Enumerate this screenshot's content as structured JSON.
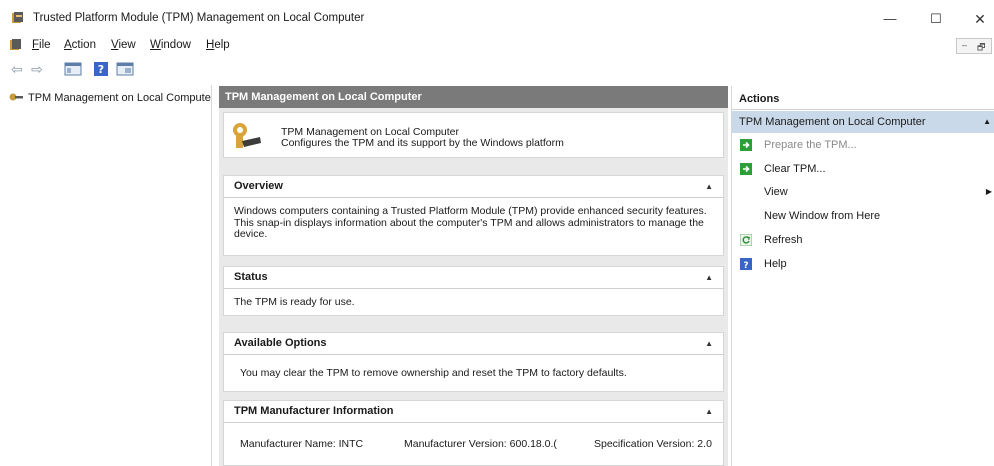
{
  "window": {
    "title": "Trusted Platform Module (TPM) Management on Local Computer",
    "minimize_glyph": "—",
    "maximize_glyph": "☐",
    "close_glyph": "✕"
  },
  "menu": {
    "items": [
      {
        "label": "File",
        "accel": "F",
        "rest": "ile"
      },
      {
        "label": "Action",
        "accel": "A",
        "rest": "ction"
      },
      {
        "label": "View",
        "accel": "V",
        "rest": "iew"
      },
      {
        "label": "Window",
        "accel": "W",
        "rest": "indow"
      },
      {
        "label": "Help",
        "accel": "H",
        "rest": "elp"
      }
    ],
    "mdi_minimize": "–",
    "mdi_restore": "🗗"
  },
  "toolbar": {
    "back_glyph": "⇦",
    "forward_glyph": "⇨",
    "icons": [
      "console-tree-icon",
      "help-icon",
      "properties-icon"
    ]
  },
  "tree": {
    "root_label": "TPM Management on Local Computer"
  },
  "center": {
    "header": "TPM Management on Local Computer",
    "intro_title": "TPM Management on Local Computer",
    "intro_desc": "Configures the TPM and its support by the Windows platform",
    "overview": {
      "title": "Overview",
      "text": "Windows computers containing a Trusted Platform Module (TPM) provide enhanced security features. This snap-in displays information about the computer's TPM and allows administrators to manage the device."
    },
    "status": {
      "title": "Status",
      "text": "The TPM is ready for use."
    },
    "options": {
      "title": "Available Options",
      "text": "You may clear the TPM to remove ownership and reset the TPM to factory defaults."
    },
    "manufacturer": {
      "title": "TPM Manufacturer Information",
      "name": "Manufacturer Name:  INTC",
      "version": "Manufacturer Version:  600.18.0.(",
      "spec": "Specification Version:  2.0"
    },
    "caret_glyph": "▲"
  },
  "actions": {
    "header": "Actions",
    "group": "TPM Management on Local Computer",
    "items": [
      {
        "label": "Prepare the TPM...",
        "icon": "green-action-icon",
        "enabled": false
      },
      {
        "label": "Clear TPM...",
        "icon": "green-action-icon",
        "enabled": true
      },
      {
        "label": "View",
        "icon": "",
        "enabled": true,
        "submenu": true
      },
      {
        "label": "New Window from Here",
        "icon": "",
        "enabled": true
      },
      {
        "label": "Refresh",
        "icon": "refresh-icon",
        "enabled": true
      },
      {
        "label": "Help",
        "icon": "help-icon",
        "enabled": true
      }
    ],
    "caret_glyph": "▲",
    "submenu_glyph": "▶"
  },
  "colors": {
    "header_gray": "#7a7a7a",
    "selection_blue": "#c9d9ea",
    "action_green": "#2e9e3a",
    "help_blue": "#3a64c8"
  }
}
